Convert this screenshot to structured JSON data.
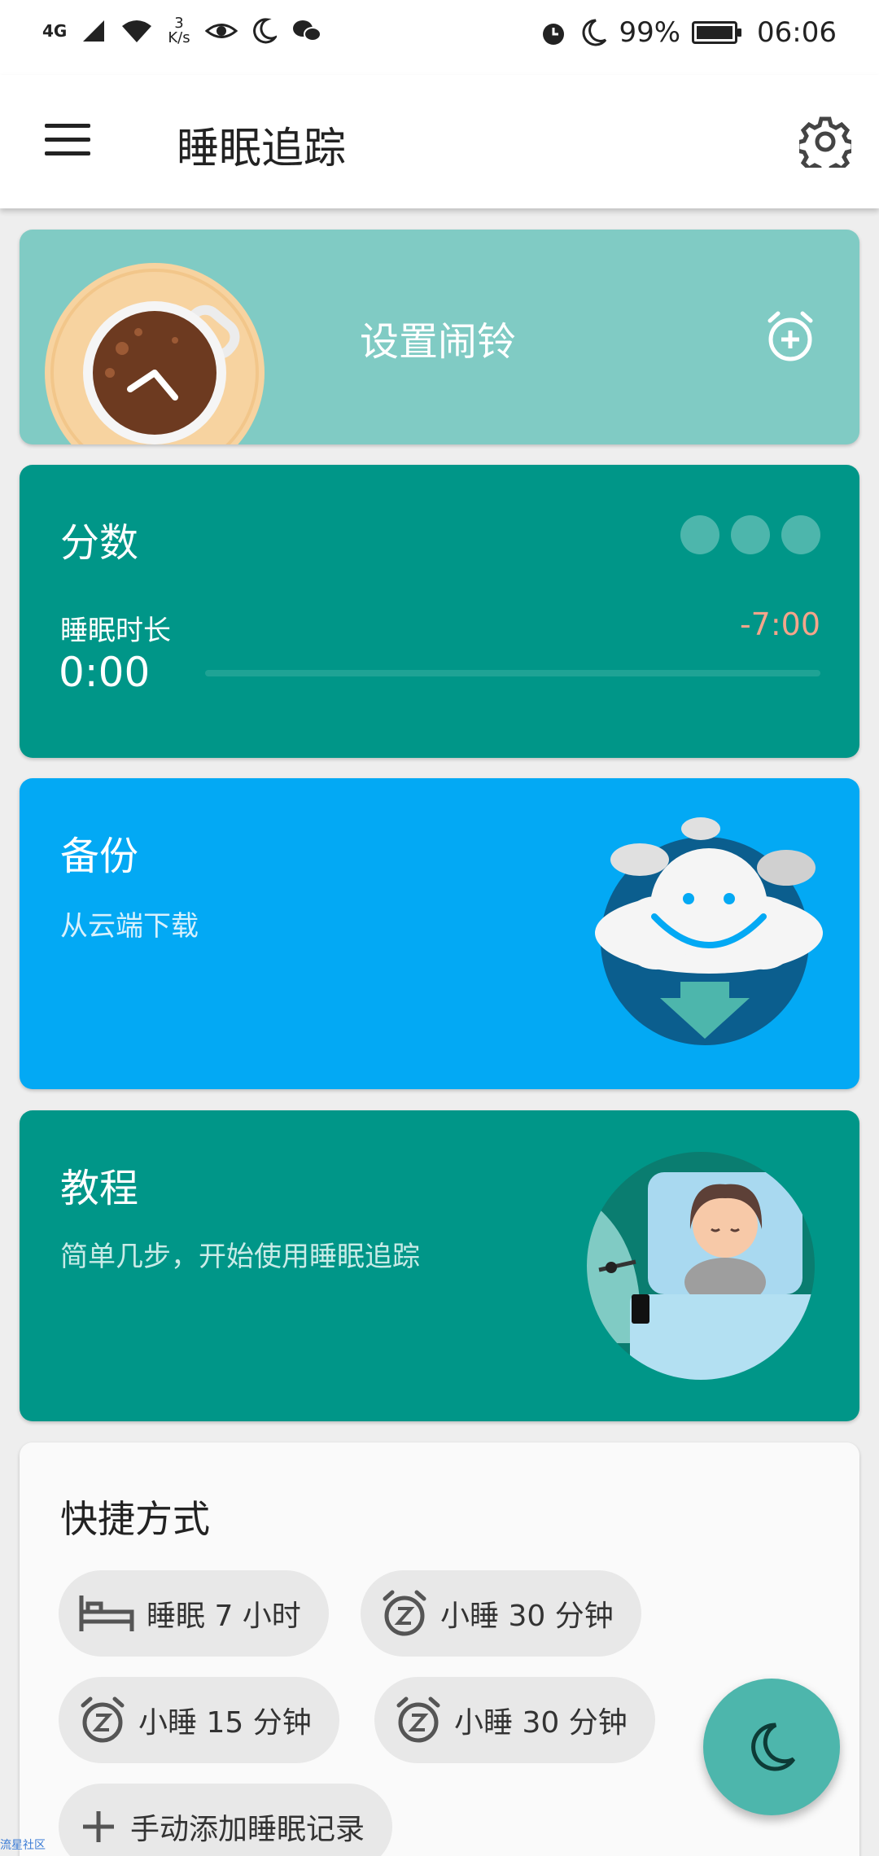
{
  "status_bar": {
    "network": "4G",
    "speed_value": "3",
    "speed_unit": "K/s",
    "battery": "99%",
    "time": "06:06"
  },
  "app_bar": {
    "title": "睡眠追踪",
    "menu_icon": "hamburger-menu-icon",
    "settings_icon": "gear-icon"
  },
  "alarm_card": {
    "label": "设置闹铃",
    "icon": "alarm-add-icon"
  },
  "score_card": {
    "title": "分数",
    "duration_label": "睡眠时长",
    "duration_value": "0:00",
    "difference": "-7:00"
  },
  "backup_card": {
    "title": "备份",
    "subtitle": "从云端下载"
  },
  "tutorial_card": {
    "title": "教程",
    "subtitle": "简单几步，开始使用睡眠追踪"
  },
  "shortcuts": {
    "title": "快捷方式",
    "chips": [
      {
        "label": "睡眠 7 小时",
        "icon": "bed-icon"
      },
      {
        "label": "小睡 30 分钟",
        "icon": "snooze-icon"
      },
      {
        "label": "小睡 15 分钟",
        "icon": "snooze-icon"
      },
      {
        "label": "小睡 30 分钟",
        "icon": "snooze-icon"
      },
      {
        "label": "手动添加睡眠记录",
        "icon": "plus-icon"
      }
    ]
  },
  "fab": {
    "icon": "moon-icon"
  },
  "watermark": "流星社区",
  "colors": {
    "teal": "#009688",
    "light_teal": "#80cbc4",
    "blue": "#03a9f4",
    "fab": "#4db6ac",
    "diff_text": "#f4a58b"
  }
}
